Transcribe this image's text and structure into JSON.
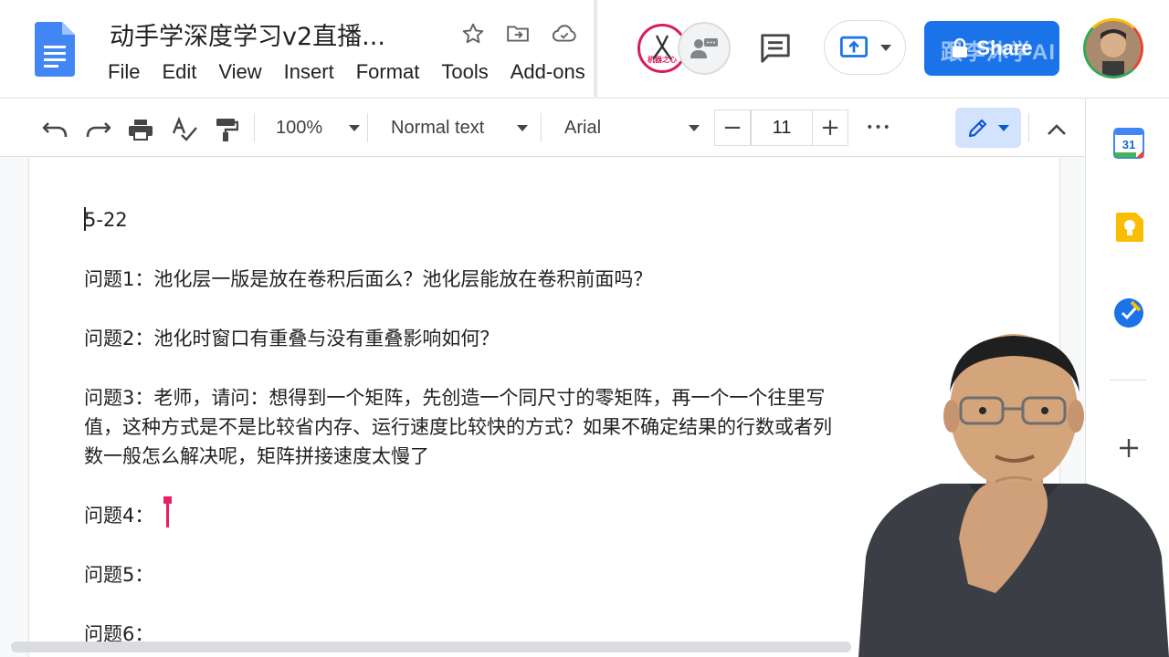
{
  "app": {
    "doc_title": "动手学深度学习v2直播...",
    "menu": [
      "File",
      "Edit",
      "View",
      "Insert",
      "Format",
      "Tools",
      "Add-ons"
    ]
  },
  "header": {
    "share_label": "Share",
    "share_watermark": "跟李沐学AI",
    "avatar_a_label": "机器之心"
  },
  "toolbar": {
    "zoom": "100%",
    "style": "Normal text",
    "font": "Arial",
    "font_size": "11",
    "minus": "−",
    "plus": "+",
    "more": "•••"
  },
  "side_panel": {
    "calendar_day": "31"
  },
  "document": {
    "date": "5-22",
    "paragraphs": [
      "问题1：池化层一版是放在卷积后面么？池化层能放在卷积前面吗？",
      "问题2：池化时窗口有重叠与没有重叠影响如何？",
      "问题3：老师，请问：想得到一个矩阵，先创造一个同尺寸的零矩阵，再一个一个往里写值，这种方式是不是比较省内存、运行速度比较快的方式？如果不确定结果的行数或者列数一般怎么解决呢，矩阵拼接速度太慢了",
      "问题4：",
      "问题5：",
      "问题6："
    ]
  },
  "colors": {
    "accent": "#1a73e8",
    "collaborator": "#e91e63",
    "edit_mode_bg": "#d3e3fd"
  }
}
